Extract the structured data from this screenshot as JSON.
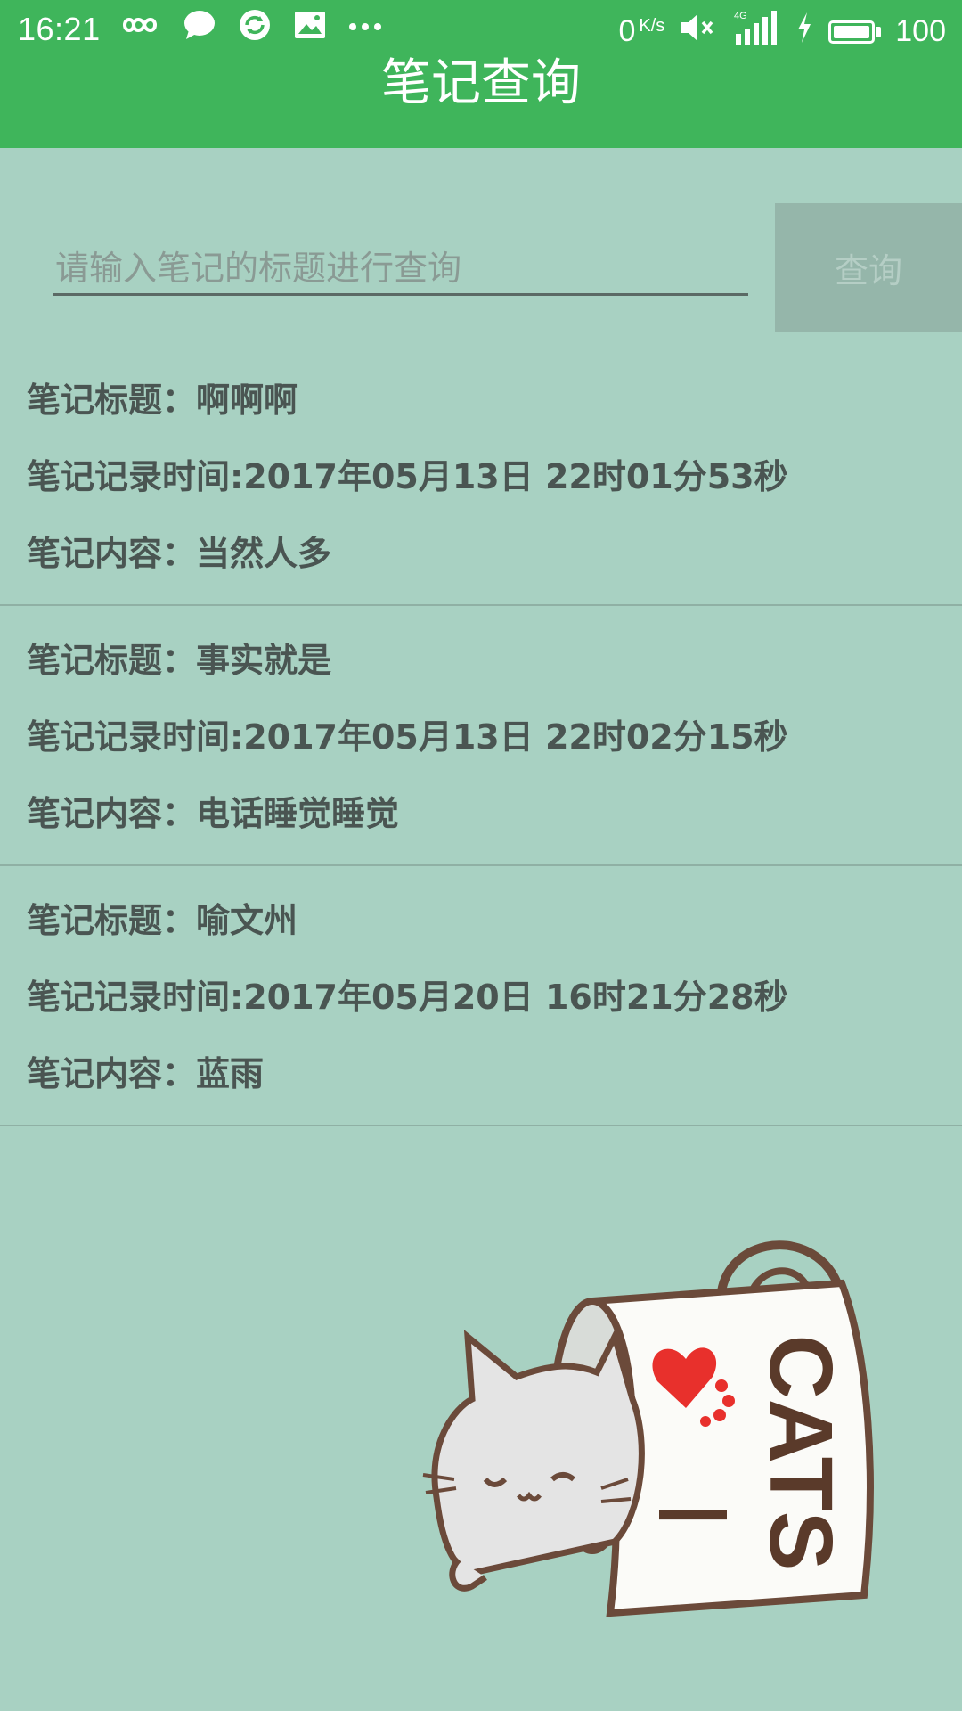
{
  "status_bar": {
    "time": "16:21",
    "net_speed_value": "0",
    "net_speed_unit": "K/s",
    "network_type": "4G",
    "battery_level": "100",
    "left_icons": [
      "infinity-icon",
      "chat-bubble-icon",
      "sync-icon",
      "image-icon",
      "more-dots-icon"
    ],
    "right_icons": [
      "mute-icon",
      "signal-icon",
      "charging-icon",
      "battery-icon"
    ]
  },
  "header": {
    "title": "笔记查询",
    "color": "#3fb55b"
  },
  "search": {
    "placeholder": "请输入笔记的标题进行查询",
    "value": "",
    "button_label": "查询"
  },
  "notes": [
    {
      "title_line": "笔记标题：啊啊啊",
      "time_line": "笔记记录时间:2017年05月13日 22时01分53秒",
      "content_line": "笔记内容：当然人多"
    },
    {
      "title_line": "笔记标题：事实就是",
      "time_line": "笔记记录时间:2017年05月13日 22时02分15秒",
      "content_line": "笔记内容：电话睡觉睡觉"
    },
    {
      "title_line": "笔记标题：喻文州",
      "time_line": "笔记记录时间:2017年05月20日 16时21分28秒",
      "content_line": "笔记内容：蓝雨"
    }
  ],
  "background_art": {
    "mug_text_i": "I",
    "mug_text_cats": "CATS"
  }
}
